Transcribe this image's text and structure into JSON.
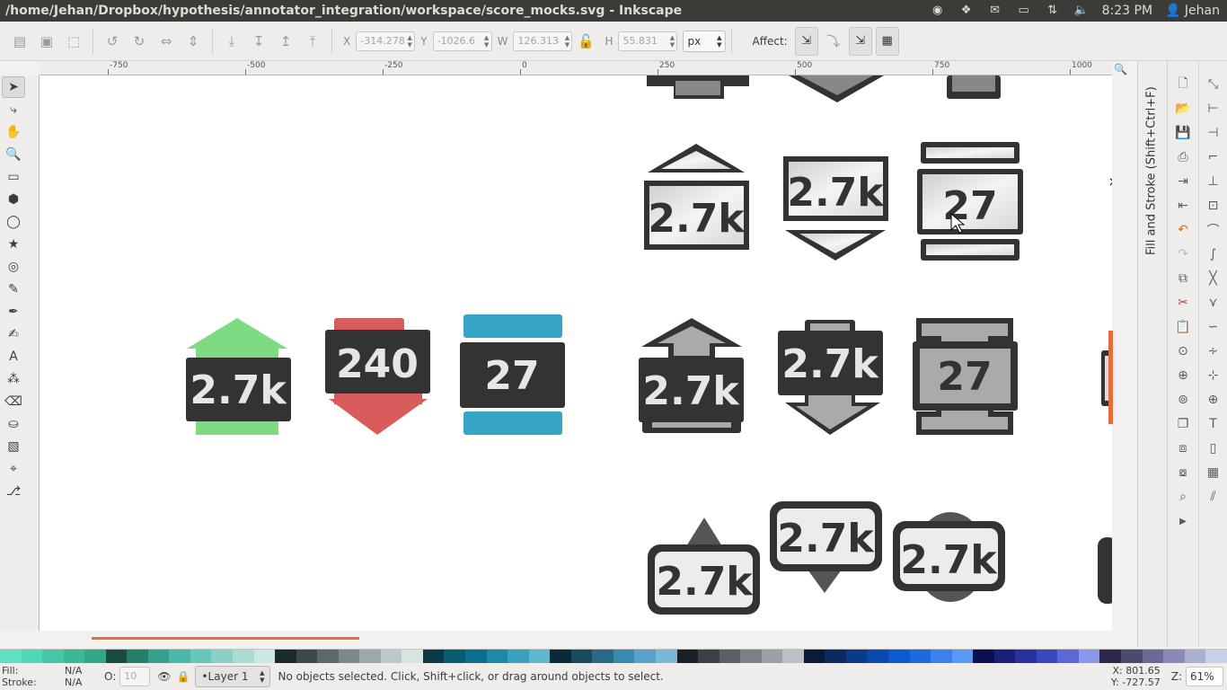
{
  "window": {
    "title": "/home/Jehan/Dropbox/hypothesis/annotator_integration/workspace/score_mocks.svg - Inkscape"
  },
  "tray": {
    "time": "8:23 PM",
    "user": "Jehan",
    "icons": [
      "spotify-icon",
      "dropbox-icon",
      "mail-icon",
      "battery-icon",
      "network-icon",
      "volume-icon"
    ]
  },
  "toolbar": {
    "x_label": "X",
    "x_value": "-314.278",
    "y_label": "Y",
    "y_value": "-1026.6",
    "w_label": "W",
    "w_value": "126.313",
    "h_label": "H",
    "h_value": "55.831",
    "unit": "px",
    "affect_label": "Affect:"
  },
  "ruler": {
    "labels": [
      "-750",
      "-500",
      "-250",
      "0",
      "250",
      "500",
      "750",
      "1000"
    ]
  },
  "dock": {
    "label": "Fill and Stroke (Shift+Ctrl+F)"
  },
  "canvas": {
    "colored_badges": [
      {
        "text": "2.7k",
        "color": "#7fdb83",
        "kind": "up"
      },
      {
        "text": "240",
        "color": "#d95c5c",
        "kind": "down"
      },
      {
        "text": "27",
        "color": "#35a6c8",
        "kind": "both"
      }
    ],
    "light_badges": [
      {
        "text": "2.7k",
        "kind": "up"
      },
      {
        "text": "2.7k",
        "kind": "down"
      },
      {
        "text": "27",
        "kind": "both"
      }
    ],
    "gray_badges": [
      {
        "text": "2.7k",
        "kind": "up"
      },
      {
        "text": "2.7k",
        "kind": "down"
      },
      {
        "text": "27",
        "kind": "both"
      }
    ],
    "bubble_badges": [
      {
        "text": "2.7k",
        "kind": "up"
      },
      {
        "text": "2.7k",
        "kind": "down"
      },
      {
        "text": "2.7k",
        "kind": "both"
      }
    ]
  },
  "status": {
    "fill_label": "Fill:",
    "fill_value": "N/A",
    "stroke_label": "Stroke:",
    "stroke_value": "N/A",
    "opacity_label": "O:",
    "opacity_value": "10",
    "layer": "•Layer 1",
    "message": "No objects selected. Click, Shift+click, or drag around objects to select.",
    "x_coord": "X:  801.65",
    "y_coord": "Y: -727.57",
    "zoom_label": "Z:",
    "zoom_value": "61%"
  },
  "colors": {
    "accent": "#e96b3c",
    "dark": "#333333"
  }
}
